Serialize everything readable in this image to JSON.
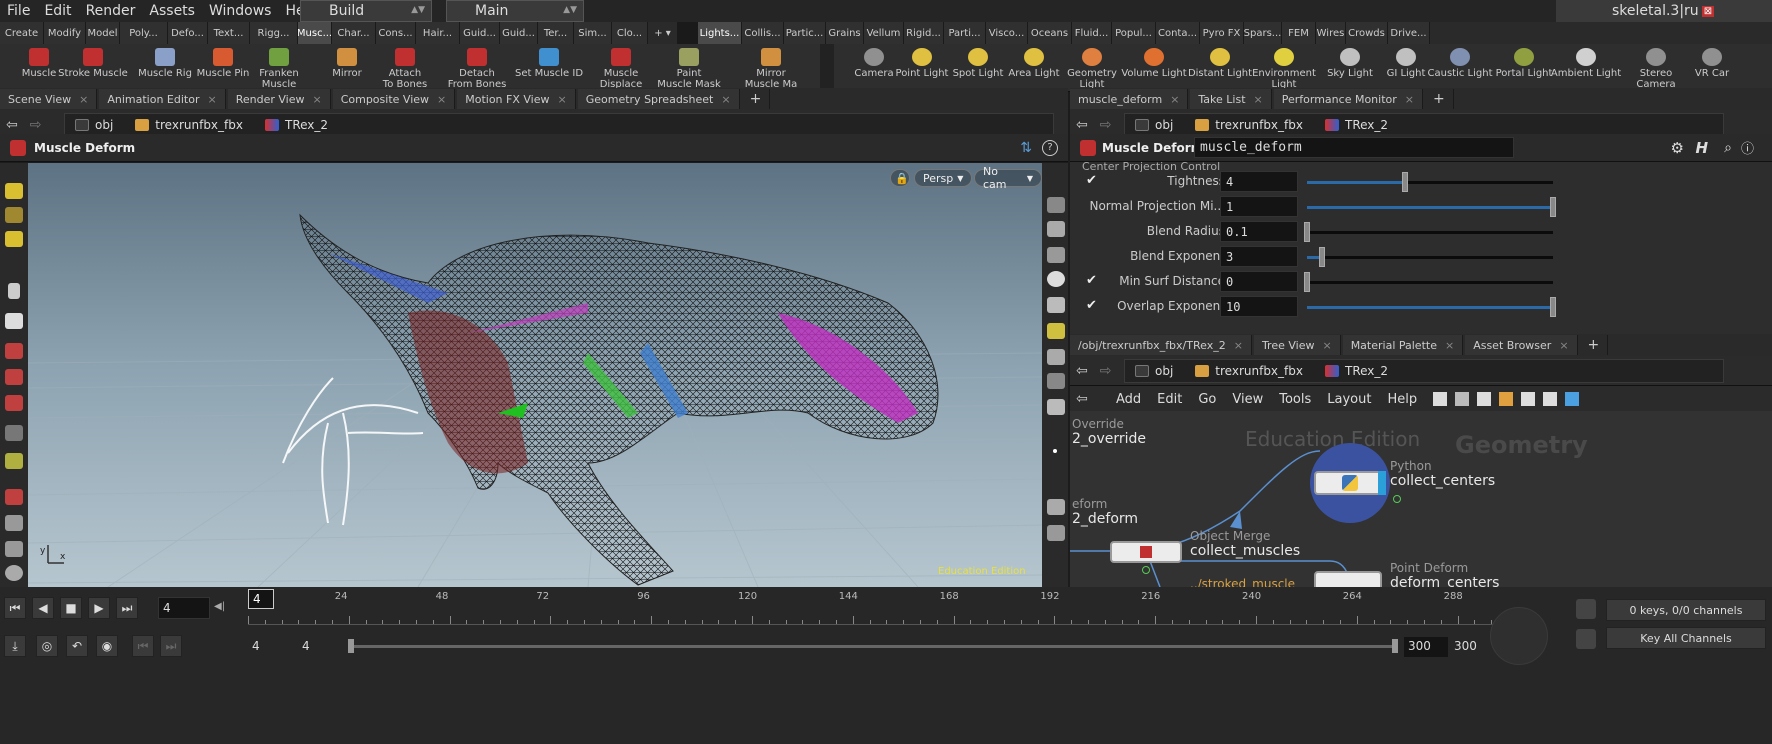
{
  "menu": [
    "File",
    "Edit",
    "Render",
    "Assets",
    "Windows",
    "Help"
  ],
  "desktop": "Build",
  "context": "Main",
  "scene_file": "skeletal.3|ru",
  "shelf_tabs_left": [
    "Create",
    "Modify",
    "Model",
    "Poly...",
    "Defo...",
    "Text...",
    "Rigg...",
    "Musc...",
    "Char...",
    "Cons...",
    "Hair...",
    "Guid...",
    "Guid...",
    "Ter...",
    "Sim...",
    "Clo..."
  ],
  "shelf_tabs_right": [
    "Lights...",
    "Collis...",
    "Partic...",
    "Grains",
    "Vellum",
    "Rigid...",
    "Parti...",
    "Visco...",
    "Oceans",
    "Fluid...",
    "Popul...",
    "Conta...",
    "Pyro FX",
    "Spars...",
    "FEM",
    "Wires",
    "Crowds",
    "Drive..."
  ],
  "tools_left": [
    {
      "label": "Muscle",
      "color": "#c03030"
    },
    {
      "label": "Stroke Muscle",
      "color": "#c03030"
    },
    {
      "label": "Muscle Rig",
      "color": "#8aa0c8"
    },
    {
      "label": "Muscle Pin",
      "color": "#d85a30"
    },
    {
      "label": "Franken\nMuscle",
      "color": "#70a040"
    },
    {
      "label": "Mirror",
      "color": "#d09040"
    },
    {
      "label": "Attach\nTo Bones",
      "color": "#c03030"
    },
    {
      "label": "Detach\nFrom Bones",
      "color": "#c03030"
    },
    {
      "label": "Set Muscle ID",
      "color": "#4090d0"
    },
    {
      "label": "Muscle\nDisplace",
      "color": "#c03030"
    },
    {
      "label": "Paint\nMuscle Mask",
      "color": "#9aa060"
    },
    {
      "label": "Mirror\nMuscle Ma",
      "color": "#d09040"
    }
  ],
  "tools_right": [
    {
      "label": "Camera",
      "color": "#909090"
    },
    {
      "label": "Point Light",
      "color": "#e0c040"
    },
    {
      "label": "Spot Light",
      "color": "#e0c040"
    },
    {
      "label": "Area Light",
      "color": "#e0c040"
    },
    {
      "label": "Geometry\nLight",
      "color": "#e08040"
    },
    {
      "label": "Volume Light",
      "color": "#e07030"
    },
    {
      "label": "Distant Light",
      "color": "#e0c040"
    },
    {
      "label": "Environment\nLight",
      "color": "#e0d040"
    },
    {
      "label": "Sky Light",
      "color": "#c0c0c0"
    },
    {
      "label": "GI Light",
      "color": "#c0c0c0"
    },
    {
      "label": "Caustic Light",
      "color": "#8090b0"
    },
    {
      "label": "Portal Light",
      "color": "#90a040"
    },
    {
      "label": "Ambient Light",
      "color": "#d0d0d0"
    },
    {
      "label": "Stereo\nCamera",
      "color": "#909090"
    },
    {
      "label": "VR Car",
      "color": "#909090"
    }
  ],
  "left_tabs": [
    "Scene View",
    "Animation Editor",
    "Render View",
    "Composite View",
    "Motion FX View",
    "Geometry Spreadsheet"
  ],
  "path": {
    "root": "obj",
    "net": "trexrunfbx_fbx",
    "node": "TRex_2"
  },
  "operator": "Muscle Deform",
  "viewport": {
    "persp": "Persp",
    "cam": "No cam",
    "watermark": "Education Edition"
  },
  "right_tabs": [
    "muscle_deform",
    "Take List",
    "Performance Monitor"
  ],
  "param_header": {
    "type": "Muscle Deform",
    "name": "muscle_deform",
    "section": "Center Projection Control"
  },
  "params": [
    {
      "label": "Tightness",
      "value": "4",
      "check": true,
      "level": 0.4
    },
    {
      "label": "Normal Projection Mi...",
      "value": "1",
      "check": false,
      "level": 1.0
    },
    {
      "label": "Blend Radius",
      "value": "0.1",
      "check": false,
      "level": 0.0
    },
    {
      "label": "Blend Exponent",
      "value": "3",
      "check": false,
      "level": 0.06
    },
    {
      "label": "Min Surf Distance",
      "value": "0",
      "check": true,
      "level": 0.0
    },
    {
      "label": "Overlap Exponent",
      "value": "10",
      "check": true,
      "level": 1.0
    }
  ],
  "net_tabs": [
    "/obj/trexrunfbx_fbx/TRex_2",
    "Tree View",
    "Material Palette",
    "Asset Browser"
  ],
  "net_menu": [
    "Add",
    "Edit",
    "Go",
    "View",
    "Tools",
    "Layout",
    "Help"
  ],
  "network": {
    "edu": "Education Edition",
    "context": "Geometry",
    "nodes": [
      {
        "type": "Override",
        "name": "2_override"
      },
      {
        "type": "eform",
        "name": "2_deform"
      },
      {
        "type": "Python",
        "name": "collect_centers"
      },
      {
        "type": "Object Merge",
        "name": "collect_muscles"
      },
      {
        "type": "Point Deform",
        "name": "deform_centers"
      }
    ],
    "path_text": "../stroked_muscle"
  },
  "timeline": {
    "frame": "4",
    "cursor_frame": "4",
    "ticks": [
      "24",
      "48",
      "72",
      "96",
      "120",
      "144",
      "168",
      "192",
      "216",
      "240",
      "264",
      "288"
    ],
    "start": "4",
    "start2": "4",
    "end": "300",
    "end2": "300",
    "keys": "0 keys, 0/0 channels",
    "key_all": "Key All Channels"
  }
}
